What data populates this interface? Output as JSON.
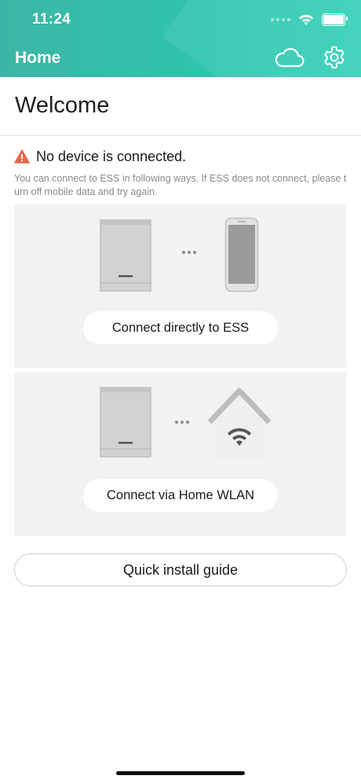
{
  "status_bar": {
    "time": "11:24"
  },
  "header": {
    "title": "Home",
    "cloud_icon": "cloud-icon",
    "settings_icon": "gear-icon"
  },
  "welcome_title": "Welcome",
  "alert": {
    "icon": "warning-icon",
    "text": "No device is connected.",
    "color": "#e8674a"
  },
  "hint_text": "You can connect to ESS in following ways. If ESS does not connect, please turn off mobile data and try again.",
  "options": [
    {
      "label": "Connect directly to ESS",
      "left_icon": "ess-device-icon",
      "right_icon": "phone-icon"
    },
    {
      "label": "Connect via Home WLAN",
      "left_icon": "ess-device-icon",
      "right_icon": "home-wlan-icon"
    }
  ],
  "guide_button": "Quick install guide",
  "colors": {
    "header_start": "#3cb6a4",
    "header_end": "#35d0b8",
    "card_bg": "#f2f2f2"
  }
}
